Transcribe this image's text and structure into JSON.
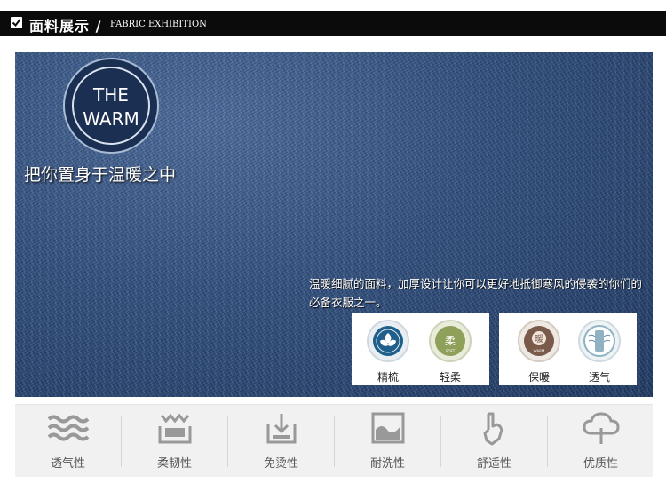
{
  "header": {
    "title": "面料展示 /",
    "subtitle": "FABRIC EXHIBITION"
  },
  "hero": {
    "logo_line1": "THE",
    "logo_line2": "WARM",
    "slogan": "把你置身于温暖之中",
    "description": "温暖细腻的面料，加厚设计让你可以更好地抵御寒风的侵袭的你们的必备衣服之一。"
  },
  "badges": [
    {
      "label": "精梳",
      "icon": "cotton-icon",
      "color": "#1f5f8b"
    },
    {
      "label": "轻柔",
      "icon": "soft-icon",
      "color": "#8ea05a",
      "glyph": "柔",
      "sub": "SOFT"
    },
    {
      "label": "保暖",
      "icon": "warm-icon",
      "color": "#7a5a4a",
      "glyph": "暖",
      "sub": "WARM"
    },
    {
      "label": "透气",
      "icon": "breathable-icon",
      "color": "#8fb3c4"
    }
  ],
  "features": [
    {
      "label": "透气性",
      "icon": "wave-icon"
    },
    {
      "label": "柔韧性",
      "icon": "flex-icon"
    },
    {
      "label": "免烫性",
      "icon": "iron-free-icon"
    },
    {
      "label": "耐洗性",
      "icon": "wash-icon"
    },
    {
      "label": "舒适性",
      "icon": "hand-icon"
    },
    {
      "label": "优质性",
      "icon": "quality-icon"
    }
  ],
  "colors": {
    "header_bg": "#0b0b0b",
    "denim": "#2b4a7a",
    "feature_bg": "#f1f1f1",
    "icon_gray": "#999999"
  }
}
